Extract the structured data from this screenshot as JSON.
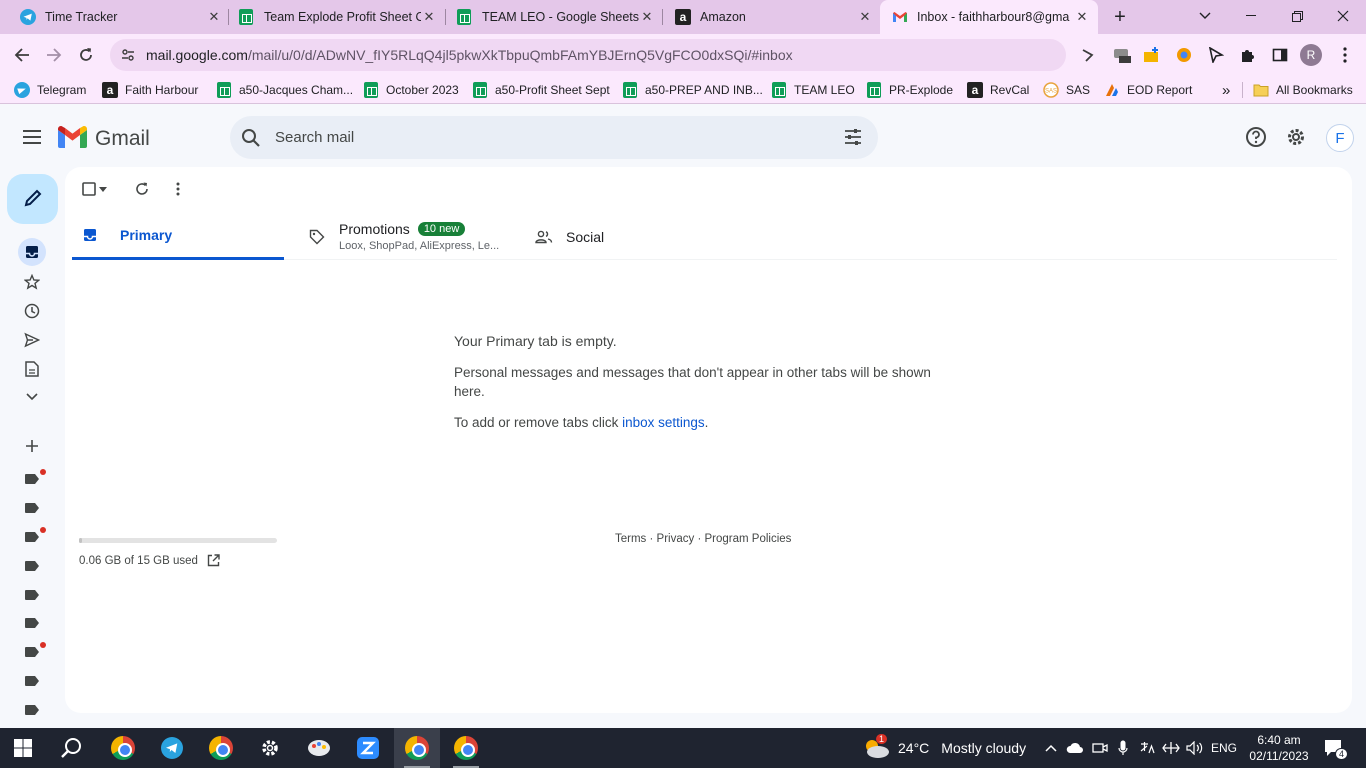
{
  "browser": {
    "tabs": [
      {
        "title": "Time Tracker",
        "icon": "telegram-icon"
      },
      {
        "title": "Team Explode Profit Sheet O",
        "icon": "sheets-icon"
      },
      {
        "title": "TEAM LEO - Google Sheets",
        "icon": "sheets-icon"
      },
      {
        "title": "Amazon",
        "icon": "amazon-icon"
      },
      {
        "title": "Inbox - faithharbour8@gma",
        "icon": "gmail-icon",
        "active": true
      }
    ],
    "url_host": "mail.google.com",
    "url_path": "/mail/u/0/d/ADwNV_fIY5RLqQ4jl5pkwXkTbpuQmbFAmYBJErnQ5VgFCO0dxSQi/#inbox",
    "profile_initial": "R"
  },
  "bookmarks": {
    "items": [
      {
        "label": "Telegram",
        "icon": "telegram-icon"
      },
      {
        "label": "Faith Harbour",
        "icon": "amazon-icon"
      },
      {
        "label": "a50-Jacques Cham...",
        "icon": "sheets-icon"
      },
      {
        "label": "October 2023",
        "icon": "sheets-icon"
      },
      {
        "label": "a50-Profit Sheet Sept",
        "icon": "sheets-icon"
      },
      {
        "label": "a50-PREP AND INB...",
        "icon": "sheets-icon"
      },
      {
        "label": "TEAM LEO",
        "icon": "sheets-icon"
      },
      {
        "label": "PR-Explode",
        "icon": "sheets-icon"
      },
      {
        "label": "RevCal",
        "icon": "amazon-icon"
      },
      {
        "label": "SAS",
        "icon": "sas-icon"
      },
      {
        "label": "EOD Report",
        "icon": "eod-icon"
      }
    ],
    "overflow": "»",
    "all_bookmarks": "All Bookmarks"
  },
  "gmail": {
    "logo_text": "Gmail",
    "search_placeholder": "Search mail",
    "account_initial": "F",
    "tabs": {
      "primary": "Primary",
      "promotions": "Promotions",
      "promotions_badge": "10 new",
      "promotions_snippet": "Loox, ShopPad, AliExpress, Le...",
      "social": "Social"
    },
    "empty": {
      "title": "Your Primary tab is empty.",
      "body": "Personal messages and messages that don't appear in other tabs will be shown here.",
      "settings_prefix": "To add or remove tabs click ",
      "settings_link": "inbox settings",
      "settings_suffix": "."
    },
    "storage": {
      "text": "0.06 GB of 15 GB used",
      "used_fraction": 0.004
    },
    "footer": {
      "terms": "Terms",
      "privacy": "Privacy",
      "policies": "Program Policies",
      "sep": " · "
    }
  },
  "taskbar": {
    "weather_temp": "24°C",
    "weather_desc": "Mostly cloudy",
    "weather_badge": "1",
    "language": "ENG",
    "time": "6:40 am",
    "date": "02/11/2023",
    "notifications": "4"
  },
  "colors": {
    "tabstrip": "#e4c7e9",
    "accent_blue": "#0b57d0",
    "compose_bg": "#c2e7ff",
    "badge_green": "#188038"
  }
}
